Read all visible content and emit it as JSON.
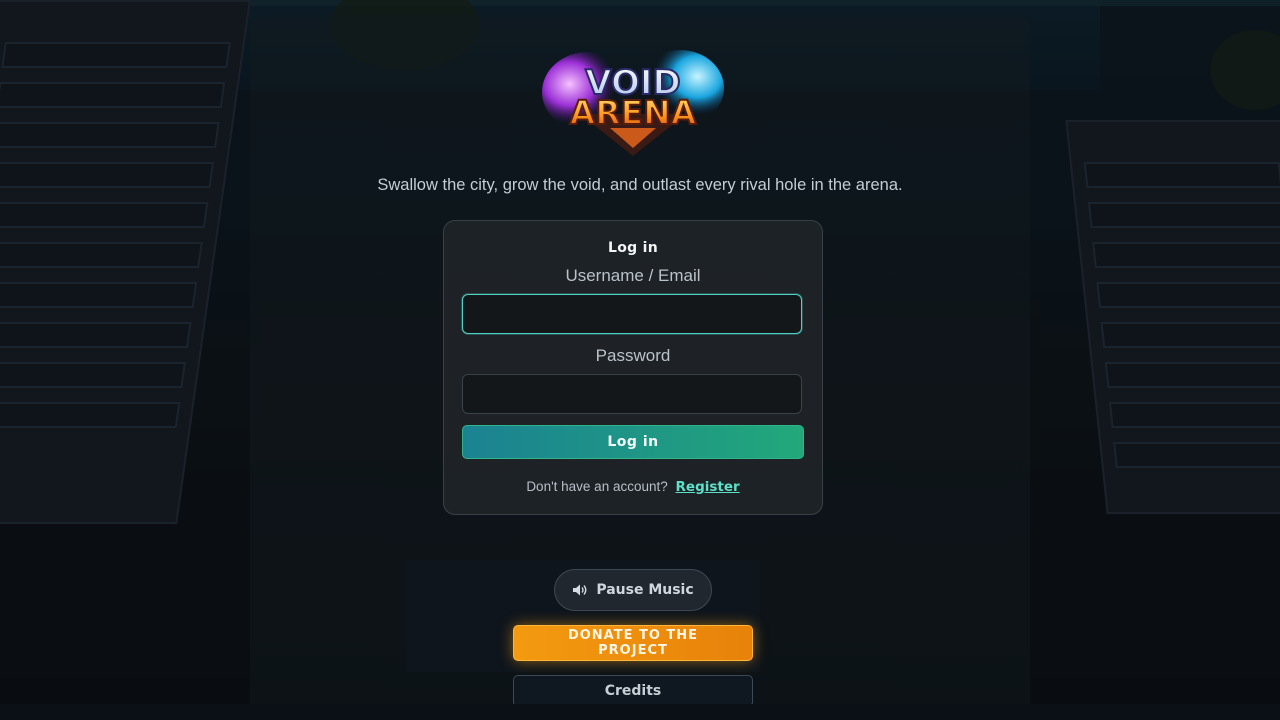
{
  "app": {
    "logo_text_top": "VOID",
    "logo_text_bottom": "ARENA",
    "tagline": "Swallow the city, grow the void, and outlast every rival hole in the arena."
  },
  "login": {
    "title": "Log in",
    "username_label": "Username / Email",
    "username_value": "",
    "password_label": "Password",
    "password_value": "",
    "submit_label": "Log in",
    "register_prompt": "Don't have an account?",
    "register_link": "Register"
  },
  "controls": {
    "music_label": "Pause Music",
    "music_icon": "speaker-icon",
    "donate_label": "DONATE TO THE PROJECT",
    "credits_label": "Credits"
  },
  "colors": {
    "accent_teal": "#4fd1c5",
    "login_gradient_start": "#1b8292",
    "login_gradient_end": "#22a87a",
    "donate_orange": "#f39a10",
    "register_link": "#5fe0c8"
  }
}
